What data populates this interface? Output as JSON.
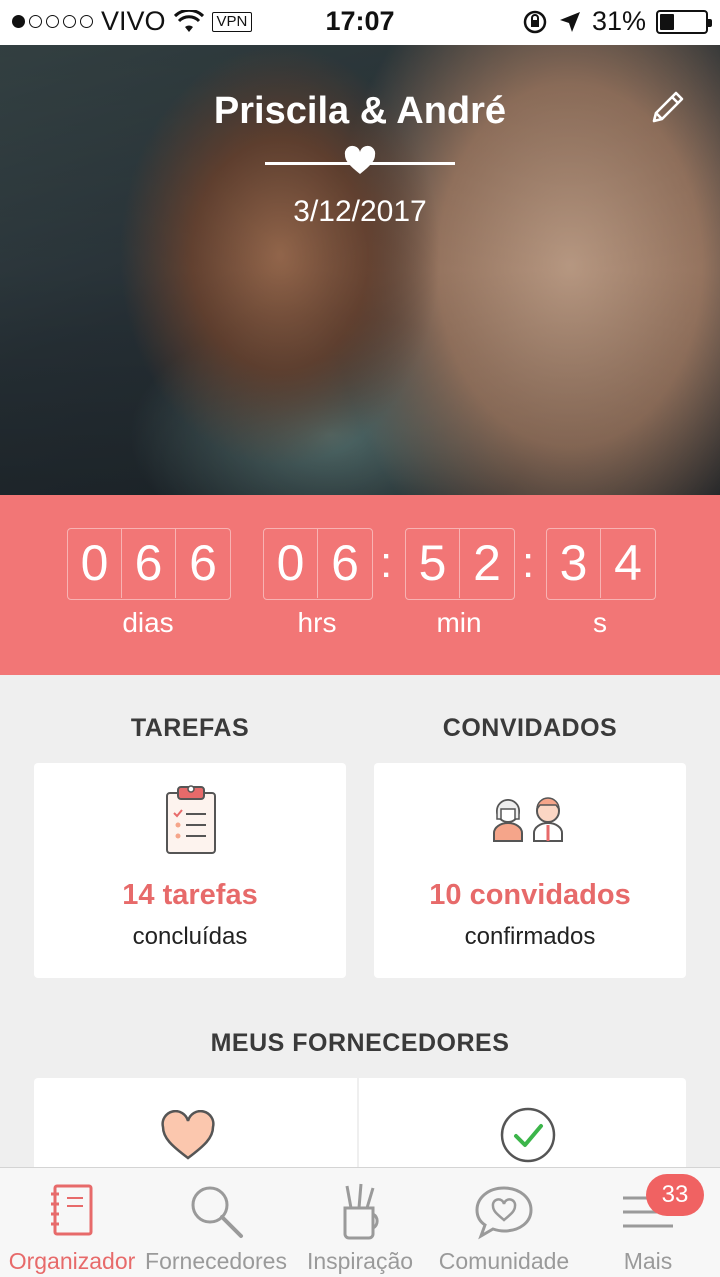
{
  "status_bar": {
    "carrier": "VIVO",
    "vpn": "VPN",
    "time": "17:07",
    "battery": "31%",
    "battery_level": 0.31,
    "signal_bars": 1
  },
  "hero": {
    "couple": "Priscila & André",
    "date": "3/12/2017"
  },
  "countdown": {
    "days": [
      "0",
      "6",
      "6"
    ],
    "hours": [
      "0",
      "6"
    ],
    "minutes": [
      "5",
      "2"
    ],
    "seconds": [
      "3",
      "4"
    ],
    "separator": ":",
    "labels": {
      "days": "dias",
      "hours": "hrs",
      "minutes": "min",
      "seconds": "s"
    }
  },
  "tasks": {
    "title": "TAREFAS",
    "count_text": "14 tarefas",
    "status": "concluídas"
  },
  "guests": {
    "title": "CONVIDADOS",
    "count_text": "10 convidados",
    "status": "confirmados"
  },
  "vendors": {
    "title": "MEUS FORNECEDORES"
  },
  "tabbar": {
    "tabs": [
      {
        "label": "Organizador",
        "icon": "notebook-icon"
      },
      {
        "label": "Fornecedores",
        "icon": "search-icon"
      },
      {
        "label": "Inspiração",
        "icon": "pencil-cup-icon"
      },
      {
        "label": "Comunidade",
        "icon": "chat-heart-icon"
      },
      {
        "label": "Mais",
        "icon": "menu-icon"
      }
    ],
    "badge": "33"
  },
  "colors": {
    "accent": "#f27676",
    "accent_text": "#e76a6a",
    "background": "#efefef"
  }
}
